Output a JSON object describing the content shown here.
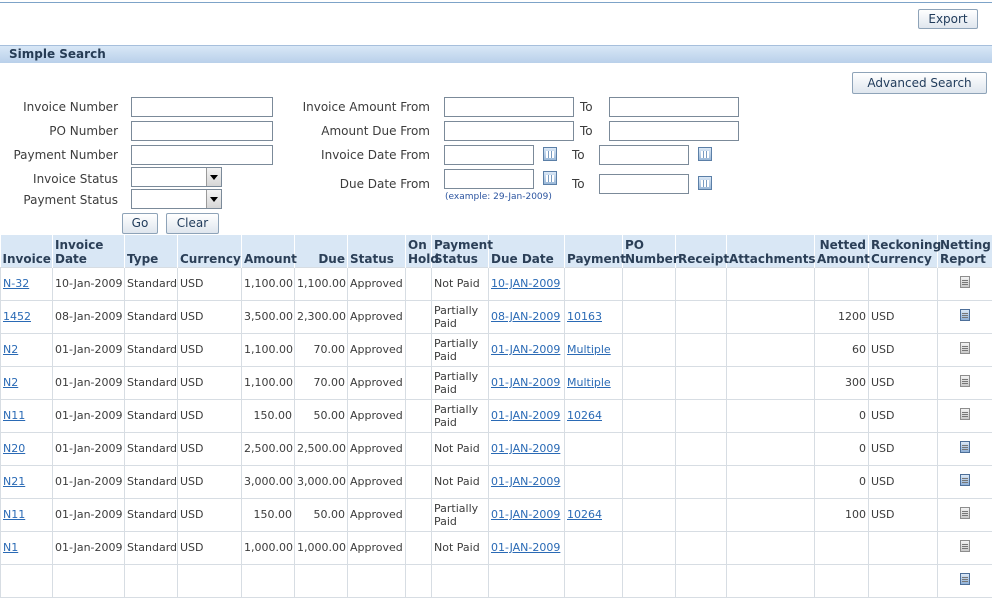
{
  "toolbar": {
    "export_label": "Export"
  },
  "search": {
    "section_title": "Simple Search",
    "advanced_label": "Advanced Search",
    "invoice_number_label": "Invoice Number",
    "po_number_label": "PO Number",
    "payment_number_label": "Payment Number",
    "invoice_status_label": "Invoice Status",
    "payment_status_label": "Payment Status",
    "invoice_amount_from_label": "Invoice Amount From",
    "amount_due_from_label": "Amount Due From",
    "invoice_date_from_label": "Invoice Date From",
    "due_date_from_label": "Due Date From",
    "to_label": "To",
    "date_hint": "(example: 29-Jan-2009)",
    "go_label": "Go",
    "clear_label": "Clear"
  },
  "table": {
    "headers": {
      "invoice": "Invoice",
      "invoice_date": "Invoice Date",
      "type": "Type",
      "currency": "Currency",
      "amount": "Amount",
      "due": "Due",
      "status": "Status",
      "on_hold": "On Hold",
      "payment_status": "Payment Status",
      "due_date": "Due Date",
      "payment": "Payment",
      "po_number": "PO Number",
      "receipt": "Receipt",
      "attachments": "Attachments",
      "netted_amount": "Netted Amount",
      "reckoning_currency": "Reckoning Currency",
      "netting_report": "Netting Report"
    },
    "rows": [
      {
        "invoice": "N-32",
        "invoice_date": "10-Jan-2009",
        "type": "Standard",
        "currency": "USD",
        "amount": "1,100.00",
        "due": "1,100.00",
        "status": "Approved",
        "on_hold": "",
        "payment_status": "Not Paid",
        "due_date": "10-JAN-2009",
        "payment": "",
        "po_number": "",
        "receipt": "",
        "attachments": "",
        "netted_amount": "",
        "reckoning_currency": "",
        "report_icon": "report-grey"
      },
      {
        "invoice": "1452",
        "invoice_date": "08-Jan-2009",
        "type": "Standard",
        "currency": "USD",
        "amount": "3,500.00",
        "due": "2,300.00",
        "status": "Approved",
        "on_hold": "",
        "payment_status": "Partially Paid",
        "due_date": "08-JAN-2009",
        "payment": "10163",
        "po_number": "",
        "receipt": "",
        "attachments": "",
        "netted_amount": "1200",
        "reckoning_currency": "USD",
        "report_icon": "report-blue"
      },
      {
        "invoice": "N2",
        "invoice_date": "01-Jan-2009",
        "type": "Standard",
        "currency": "USD",
        "amount": "1,100.00",
        "due": "70.00",
        "status": "Approved",
        "on_hold": "",
        "payment_status": "Partially Paid",
        "due_date": "01-JAN-2009",
        "payment": "Multiple",
        "po_number": "",
        "receipt": "",
        "attachments": "",
        "netted_amount": "60",
        "reckoning_currency": "USD",
        "report_icon": "report-grey"
      },
      {
        "invoice": "N2",
        "invoice_date": "01-Jan-2009",
        "type": "Standard",
        "currency": "USD",
        "amount": "1,100.00",
        "due": "70.00",
        "status": "Approved",
        "on_hold": "",
        "payment_status": "Partially Paid",
        "due_date": "01-JAN-2009",
        "payment": "Multiple",
        "po_number": "",
        "receipt": "",
        "attachments": "",
        "netted_amount": "300",
        "reckoning_currency": "USD",
        "report_icon": "report-grey"
      },
      {
        "invoice": "N11",
        "invoice_date": "01-Jan-2009",
        "type": "Standard",
        "currency": "USD",
        "amount": "150.00",
        "due": "50.00",
        "status": "Approved",
        "on_hold": "",
        "payment_status": "Partially Paid",
        "due_date": "01-JAN-2009",
        "payment": "10264",
        "po_number": "",
        "receipt": "",
        "attachments": "",
        "netted_amount": "0",
        "reckoning_currency": "USD",
        "report_icon": "report-grey"
      },
      {
        "invoice": "N20",
        "invoice_date": "01-Jan-2009",
        "type": "Standard",
        "currency": "USD",
        "amount": "2,500.00",
        "due": "2,500.00",
        "status": "Approved",
        "on_hold": "",
        "payment_status": "Not Paid",
        "due_date": "01-JAN-2009",
        "payment": "",
        "po_number": "",
        "receipt": "",
        "attachments": "",
        "netted_amount": "0",
        "reckoning_currency": "USD",
        "report_icon": "report-blue"
      },
      {
        "invoice": "N21",
        "invoice_date": "01-Jan-2009",
        "type": "Standard",
        "currency": "USD",
        "amount": "3,000.00",
        "due": "3,000.00",
        "status": "Approved",
        "on_hold": "",
        "payment_status": "Not Paid",
        "due_date": "01-JAN-2009",
        "payment": "",
        "po_number": "",
        "receipt": "",
        "attachments": "",
        "netted_amount": "0",
        "reckoning_currency": "USD",
        "report_icon": "report-blue"
      },
      {
        "invoice": "N11",
        "invoice_date": "01-Jan-2009",
        "type": "Standard",
        "currency": "USD",
        "amount": "150.00",
        "due": "50.00",
        "status": "Approved",
        "on_hold": "",
        "payment_status": "Partially Paid",
        "due_date": "01-JAN-2009",
        "payment": "10264",
        "po_number": "",
        "receipt": "",
        "attachments": "",
        "netted_amount": "100",
        "reckoning_currency": "USD",
        "report_icon": "report-grey"
      },
      {
        "invoice": "N1",
        "invoice_date": "01-Jan-2009",
        "type": "Standard",
        "currency": "USD",
        "amount": "1,000.00",
        "due": "1,000.00",
        "status": "Approved",
        "on_hold": "",
        "payment_status": "Not Paid",
        "due_date": "01-JAN-2009",
        "payment": "",
        "po_number": "",
        "receipt": "",
        "attachments": "",
        "netted_amount": "",
        "reckoning_currency": "",
        "report_icon": "report-grey"
      },
      {
        "invoice": "",
        "invoice_date": "",
        "type": "",
        "currency": "",
        "amount": "",
        "due": "",
        "status": "",
        "on_hold": "",
        "payment_status": "",
        "due_date": "",
        "payment": "",
        "po_number": "",
        "receipt": "",
        "attachments": "",
        "netted_amount": "",
        "reckoning_currency": "",
        "report_icon": "report-blue"
      }
    ]
  }
}
